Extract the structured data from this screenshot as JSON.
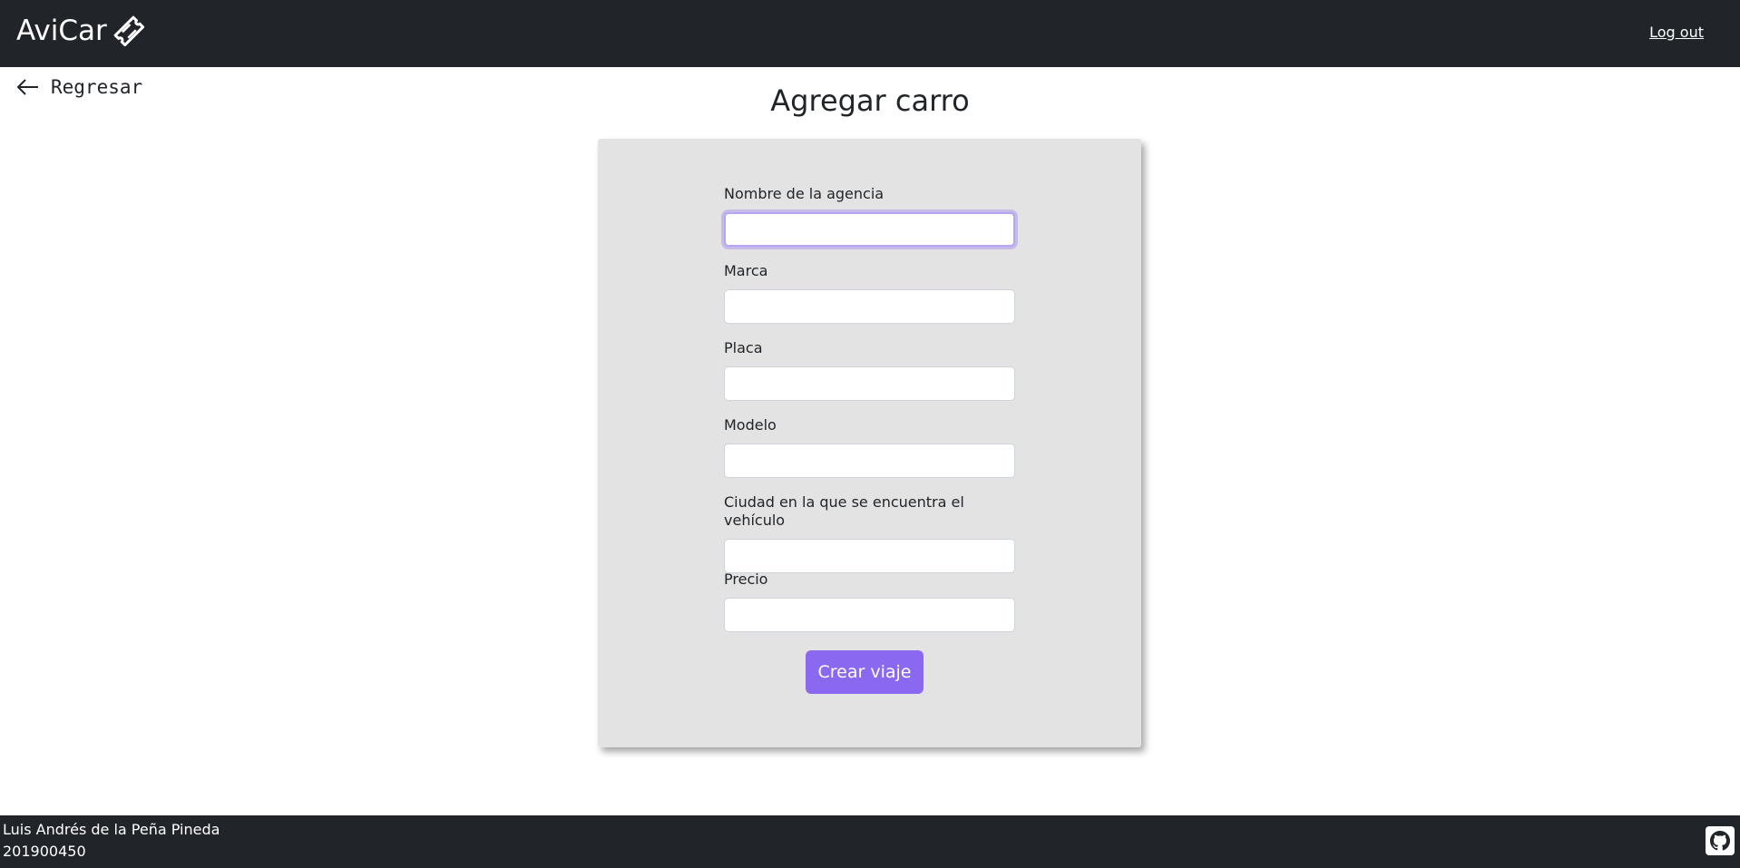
{
  "header": {
    "brand": "AviCar",
    "brand_icon": "ticket-icon",
    "logout_label": "Log out"
  },
  "nav": {
    "back_label": "Regresar",
    "back_icon": "arrow-left-icon"
  },
  "page": {
    "title": "Agregar carro"
  },
  "form": {
    "fields": [
      {
        "label": "Nombre de la agencia",
        "value": "",
        "focused": true
      },
      {
        "label": "Marca",
        "value": ""
      },
      {
        "label": "Placa",
        "value": ""
      },
      {
        "label": "Modelo",
        "value": ""
      },
      {
        "label": "Ciudad en la que se encuentra el vehículo",
        "value": ""
      },
      {
        "label": "Precio",
        "value": ""
      }
    ],
    "submit_label": "Crear viaje"
  },
  "footer": {
    "author": "Luis Andrés de la Peña Pineda",
    "student_id": "201900450",
    "github_icon": "github-icon"
  },
  "colors": {
    "navbar": "#212529",
    "card": "#e3e3e3",
    "accent": "#8b68f0",
    "focus_ring": "#b7a5f3"
  }
}
